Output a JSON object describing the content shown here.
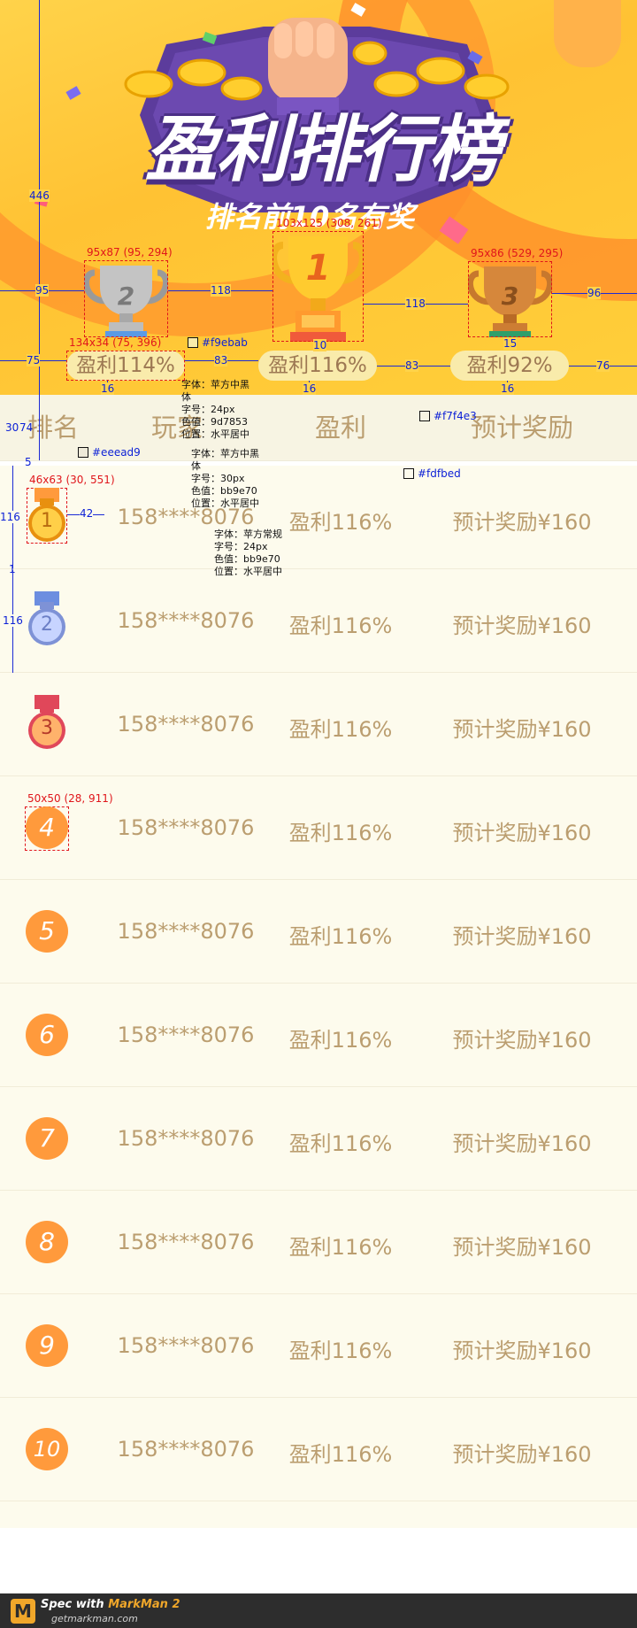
{
  "banner": {
    "title": "盈利排行榜",
    "subtitle": "排名前10名有奖"
  },
  "podium": [
    {
      "rank": "2",
      "profit": "盈利114%"
    },
    {
      "rank": "1",
      "profit": "盈利116%"
    },
    {
      "rank": "3",
      "profit": "盈利92%"
    }
  ],
  "table": {
    "headers": [
      "排名",
      "玩家",
      "盈利",
      "预计奖励"
    ],
    "rows": [
      {
        "rank": "1",
        "player": "158****8076",
        "profit": "盈利116%",
        "reward": "预计奖励¥160"
      },
      {
        "rank": "2",
        "player": "158****8076",
        "profit": "盈利116%",
        "reward": "预计奖励¥160"
      },
      {
        "rank": "3",
        "player": "158****8076",
        "profit": "盈利116%",
        "reward": "预计奖励¥160"
      },
      {
        "rank": "4",
        "player": "158****8076",
        "profit": "盈利116%",
        "reward": "预计奖励¥160"
      },
      {
        "rank": "5",
        "player": "158****8076",
        "profit": "盈利116%",
        "reward": "预计奖励¥160"
      },
      {
        "rank": "6",
        "player": "158****8076",
        "profit": "盈利116%",
        "reward": "预计奖励¥160"
      },
      {
        "rank": "7",
        "player": "158****8076",
        "profit": "盈利116%",
        "reward": "预计奖励¥160"
      },
      {
        "rank": "8",
        "player": "158****8076",
        "profit": "盈利116%",
        "reward": "预计奖励¥160"
      },
      {
        "rank": "9",
        "player": "158****8076",
        "profit": "盈利116%",
        "reward": "预计奖励¥160"
      },
      {
        "rank": "10",
        "player": "158****8076",
        "profit": "盈利116%",
        "reward": "预计奖励¥160"
      }
    ]
  },
  "annotations": {
    "trophy2_box": "95x87 (95, 294)",
    "trophy1_box": "103x125 (308, 261)",
    "trophy3_box": "95x86 (529, 295)",
    "pill_box": "134x34 (75, 396)",
    "medal1_box": "46x63 (30, 551)",
    "rank4_box": "50x50 (28, 911)",
    "color_pill": "#f9ebab",
    "color_header": "#f7f4e3",
    "color_border": "#eeead9",
    "color_row": "#fdfbed",
    "d446": "446",
    "d95": "95",
    "d118a": "118",
    "d118b": "118",
    "d96": "96",
    "d75": "75",
    "d83a": "83",
    "d83b": "83",
    "d76": "76",
    "d10": "10",
    "d15": "15",
    "d16a": "16",
    "d16b": "16",
    "d16c": "16",
    "d30": "30",
    "d74": "74",
    "d5": "5",
    "d116a": "116",
    "d116b": "116",
    "d42": "42",
    "d1": "1",
    "spec_pill": [
      "字体：苹方中黑",
      "体",
      "字号：24px",
      "色值：9d7853",
      "位置：水平居中"
    ],
    "spec_header": [
      "字体：苹方中黑",
      "体",
      "字号：30px",
      "色值：bb9e70",
      "位置：水平居中"
    ],
    "spec_row": [
      "字体：苹方常规",
      "字号：24px",
      "色值：bb9e70",
      "位置：水平居中"
    ]
  },
  "footer": {
    "brand_prefix": "Spec with ",
    "brand": "MarkMan 2",
    "url": "getmarkman.com"
  }
}
